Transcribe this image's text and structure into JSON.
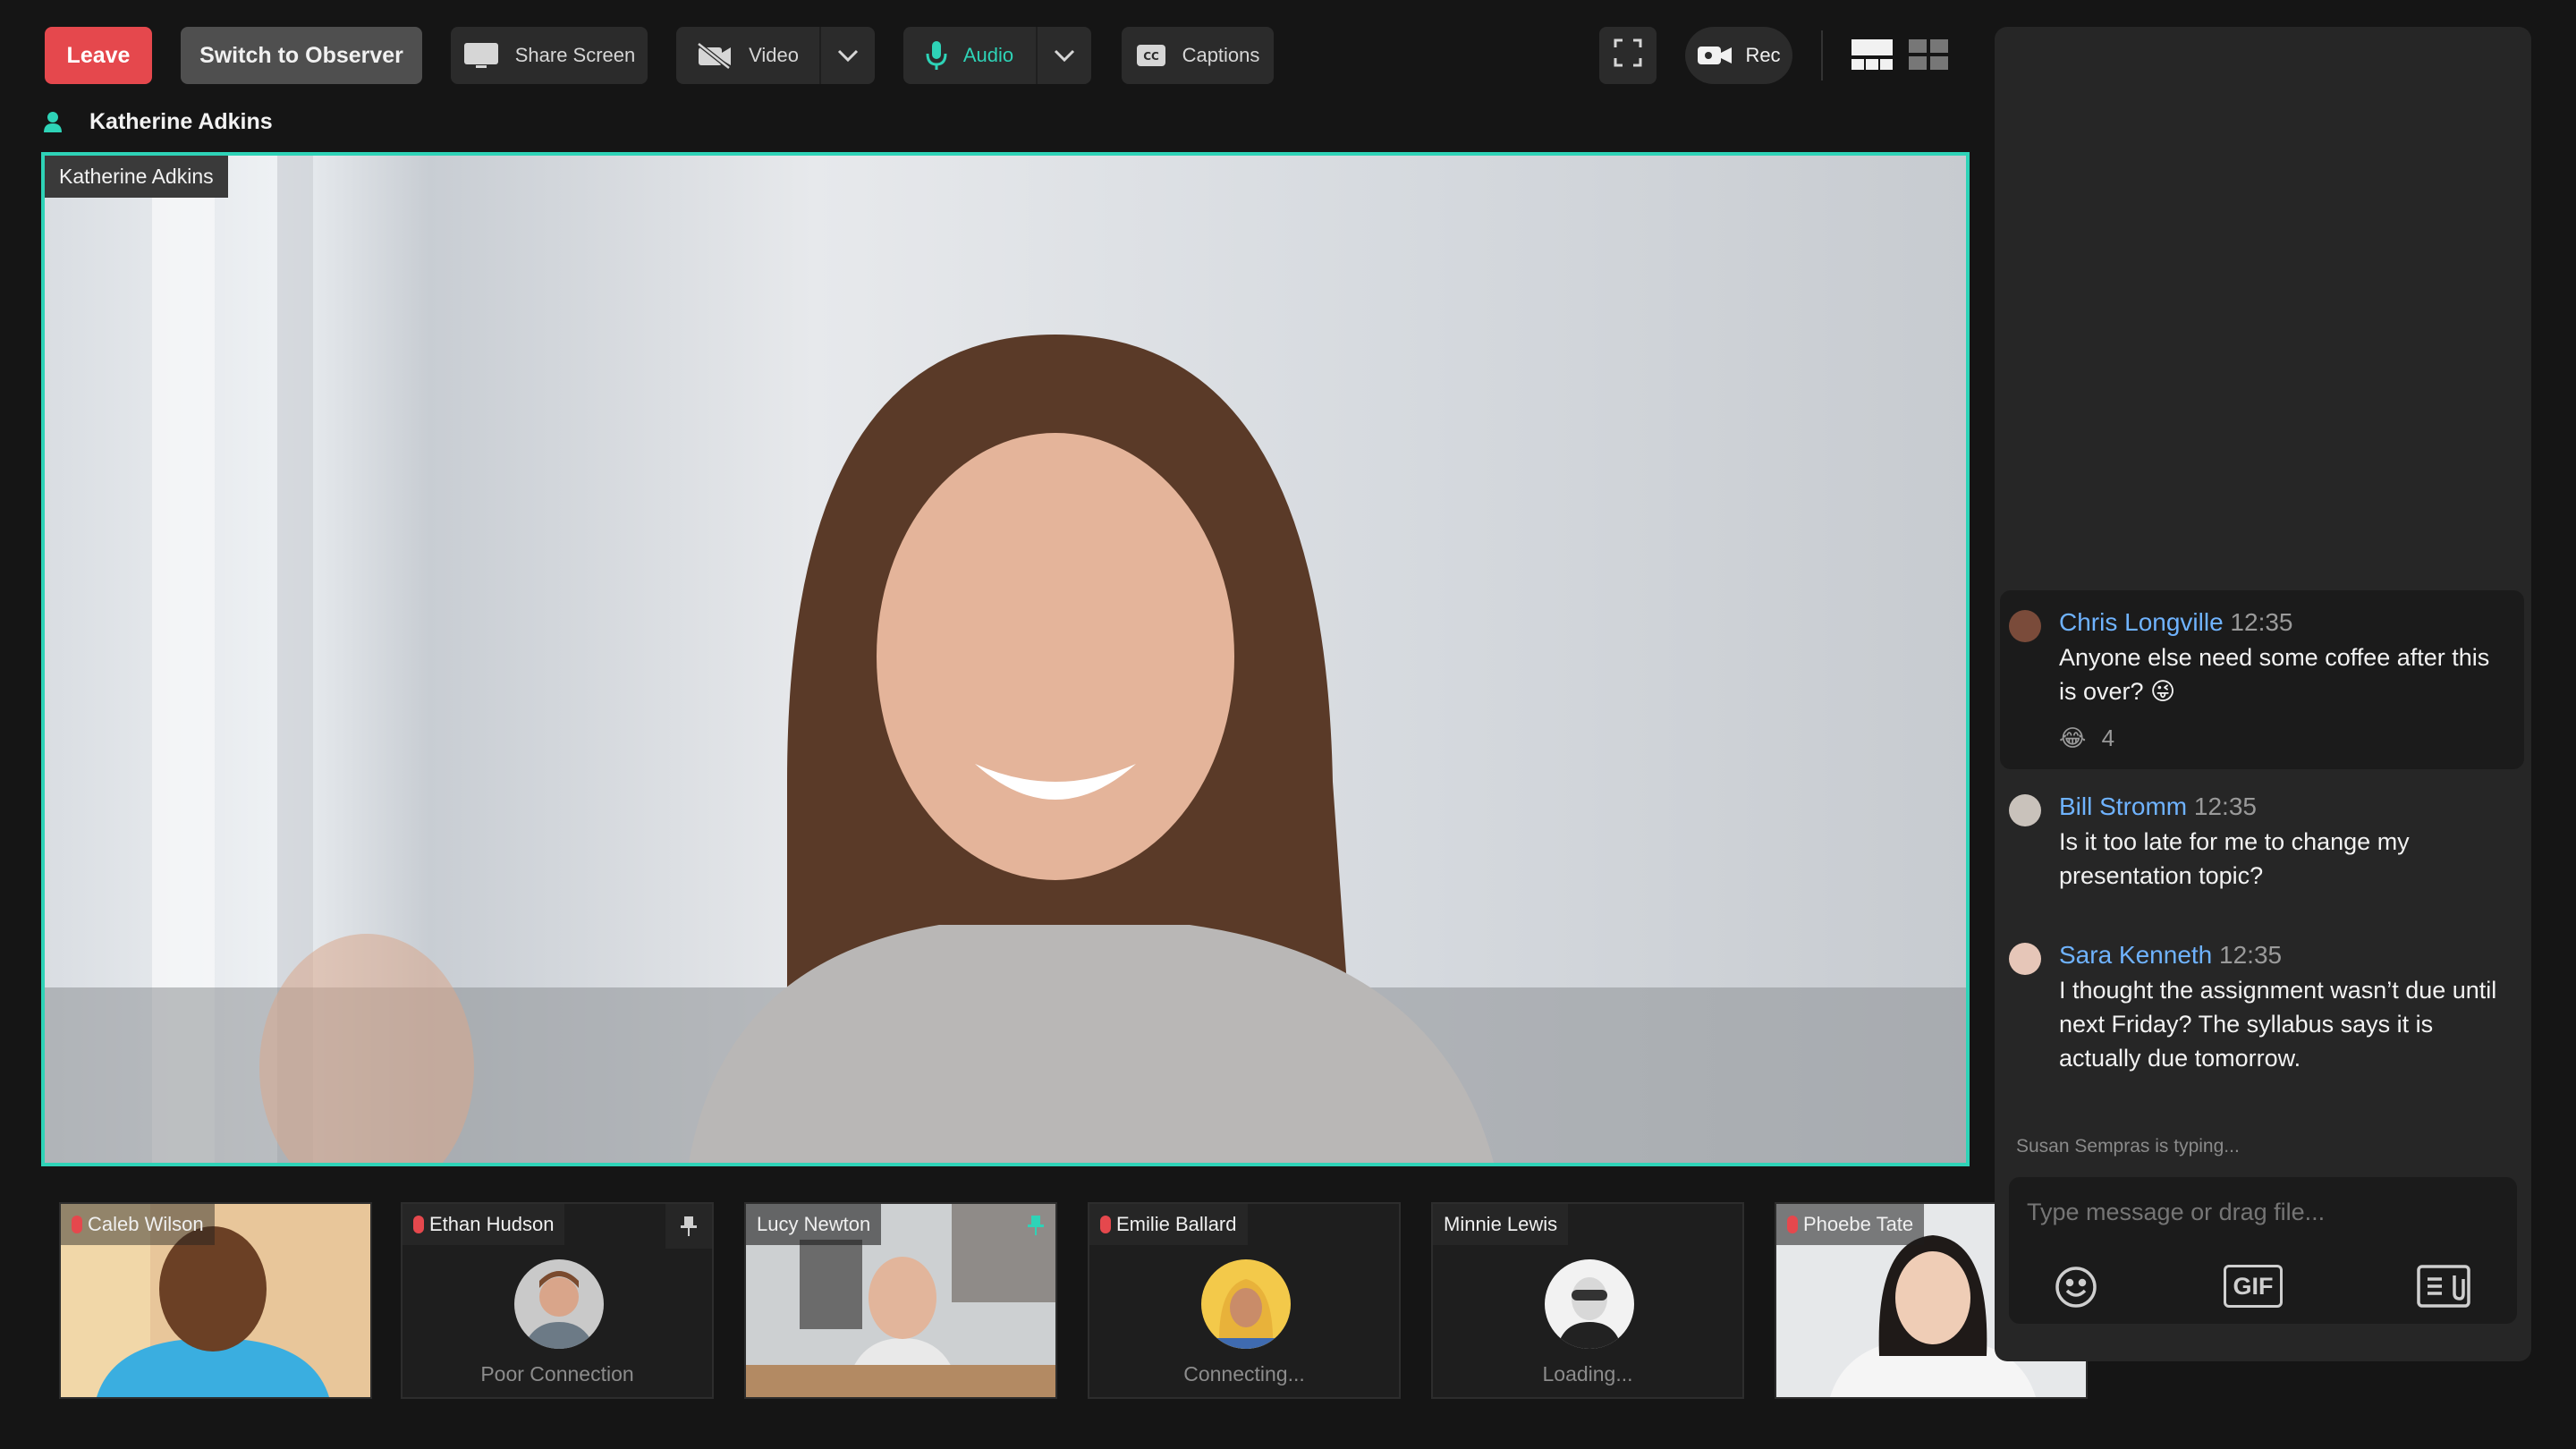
{
  "toolbar": {
    "leave": "Leave",
    "observer": "Switch to Observer",
    "share": "Share Screen",
    "video": "Video",
    "audio": "Audio",
    "captions": "Captions",
    "rec": "Rec",
    "accent": "#2ed3b7",
    "danger": "#e5484d"
  },
  "speaker": {
    "header_name": "Katherine Adkins",
    "video_label": "Katherine Adkins"
  },
  "tiles": [
    {
      "name": "Caleb Wilson",
      "status": ""
    },
    {
      "name": "Ethan Hudson",
      "status": "Poor Connection"
    },
    {
      "name": "Lucy Newton",
      "status": ""
    },
    {
      "name": "Emilie Ballard",
      "status": "Connecting..."
    },
    {
      "name": "Minnie Lewis",
      "status": "Loading..."
    },
    {
      "name": "Phoebe Tate",
      "status": ""
    }
  ],
  "chat": {
    "messages": [
      {
        "name": "Chris Longville",
        "time": "12:35",
        "text": "Anyone else need some coffee after this is over? 😜",
        "reaction": "😂",
        "reaction_count": "4"
      },
      {
        "name": "Bill Stromm",
        "time": "12:35",
        "text": "Is it too late for me to change my presentation topic?"
      },
      {
        "name": "Sara Kenneth",
        "time": "12:35",
        "text": "I thought the assignment wasn’t due until next Friday? The syllabus says it is actually due tomorrow."
      }
    ],
    "typing": "Susan Sempras is typing...",
    "placeholder": "Type message or drag file...",
    "gif": "GIF"
  }
}
